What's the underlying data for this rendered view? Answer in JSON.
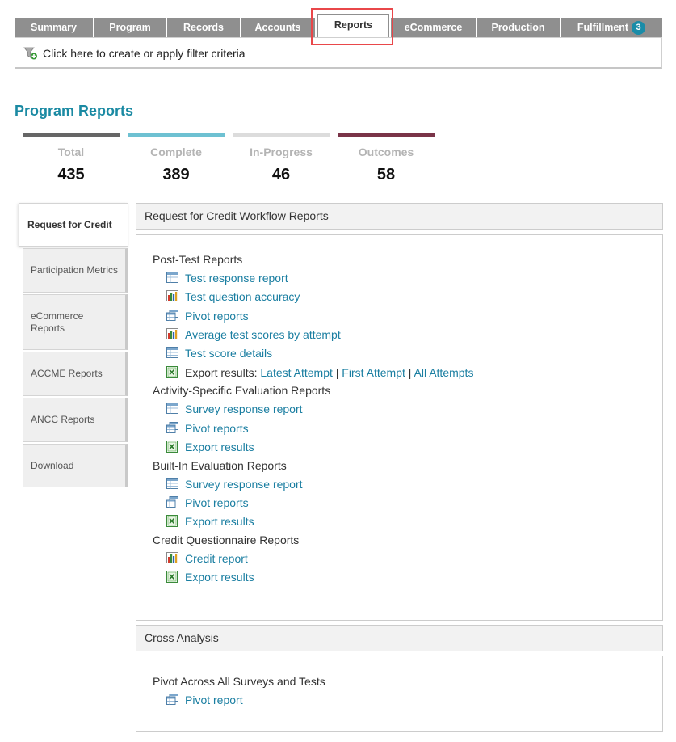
{
  "tabs": [
    {
      "label": "Summary"
    },
    {
      "label": "Program"
    },
    {
      "label": "Records"
    },
    {
      "label": "Accounts"
    },
    {
      "label": "Reports"
    },
    {
      "label": "eCommerce"
    },
    {
      "label": "Production"
    },
    {
      "label": "Fulfillment",
      "badge": "3"
    }
  ],
  "filter": {
    "label": "Click here to create or apply filter criteria",
    "icon": "filter-add-icon"
  },
  "page_title": "Program Reports",
  "stats": [
    {
      "label": "Total",
      "value": "435",
      "color": "#666666"
    },
    {
      "label": "Complete",
      "value": "389",
      "color": "#6ec1d2"
    },
    {
      "label": "In-Progress",
      "value": "46",
      "color": "#dcdcdc"
    },
    {
      "label": "Outcomes",
      "value": "58",
      "color": "#7a3448"
    }
  ],
  "side_tabs": [
    {
      "label": "Request for Credit"
    },
    {
      "label": "Participation Metrics"
    },
    {
      "label": "eCommerce Reports"
    },
    {
      "label": "ACCME Reports"
    },
    {
      "label": "ANCC Reports"
    },
    {
      "label": "Download"
    }
  ],
  "workflow_panel": {
    "title": "Request for Credit Workflow Reports",
    "sections": [
      {
        "title": "Post-Test Reports",
        "items": [
          {
            "label": "Test response report",
            "icon": "table-report-icon"
          },
          {
            "label": "Test question accuracy",
            "icon": "bar-chart-icon"
          },
          {
            "label": "Pivot reports",
            "icon": "pivot-icon"
          },
          {
            "label": "Average test scores by attempt",
            "icon": "bar-chart-icon"
          },
          {
            "label": "Test score details",
            "icon": "table-report-icon"
          },
          {
            "label": "Export results:",
            "icon": "excel-export-icon",
            "links": [
              "Latest Attempt",
              "First Attempt",
              "All Attempts"
            ],
            "separator": "|"
          }
        ]
      },
      {
        "title": "Activity-Specific Evaluation Reports",
        "items": [
          {
            "label": "Survey response report",
            "icon": "table-report-icon"
          },
          {
            "label": "Pivot reports",
            "icon": "pivot-icon"
          },
          {
            "label": "Export results",
            "icon": "excel-export-icon"
          }
        ]
      },
      {
        "title": "Built-In Evaluation Reports",
        "items": [
          {
            "label": "Survey response report",
            "icon": "table-report-icon"
          },
          {
            "label": "Pivot reports",
            "icon": "pivot-icon"
          },
          {
            "label": "Export results",
            "icon": "excel-export-icon"
          }
        ]
      },
      {
        "title": "Credit Questionnaire Reports",
        "items": [
          {
            "label": "Credit report",
            "icon": "bar-chart-icon"
          },
          {
            "label": "Export results",
            "icon": "excel-export-icon"
          }
        ]
      }
    ]
  },
  "cross_panel": {
    "title": "Cross Analysis",
    "sections": [
      {
        "title": "Pivot Across All Surveys and Tests",
        "items": [
          {
            "label": "Pivot report",
            "icon": "pivot-icon"
          }
        ]
      }
    ]
  }
}
